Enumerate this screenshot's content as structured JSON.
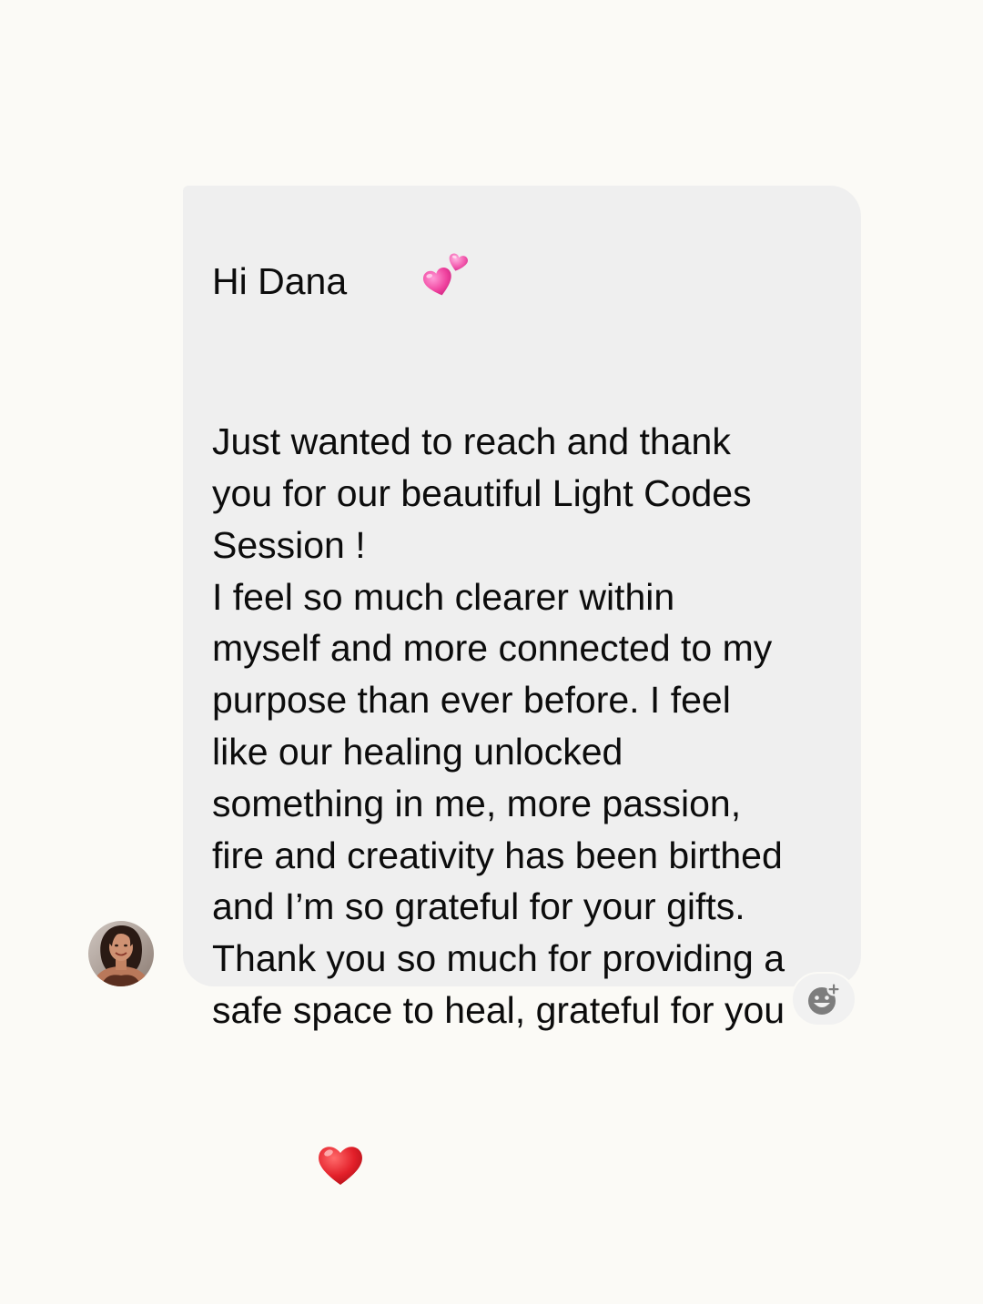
{
  "message": {
    "greeting": "Hi Dana",
    "greeting_emoji": "two-hearts-emoji",
    "lines": [
      "Just wanted to reach and thank",
      "you for our beautiful Light Codes",
      "Session !",
      "I feel so much clearer within",
      "myself and more connected to my",
      "purpose than ever before. I feel",
      "like our healing unlocked",
      "something in me, more passion,",
      "fire and creativity has been birthed",
      "and I’m so grateful for your gifts.",
      "Thank you so much for providing a",
      "safe space to heal, grateful for you"
    ],
    "closing_emoji": "red-heart-emoji"
  },
  "sender": {
    "avatar": "profile-photo"
  },
  "reaction": {
    "icon": "add-reaction-icon"
  },
  "colors": {
    "background": "#fbfaf6",
    "bubble": "#efefef",
    "text": "#0c0c0c",
    "heart_red": "#e3202a",
    "heart_pink": "#f0439f"
  }
}
